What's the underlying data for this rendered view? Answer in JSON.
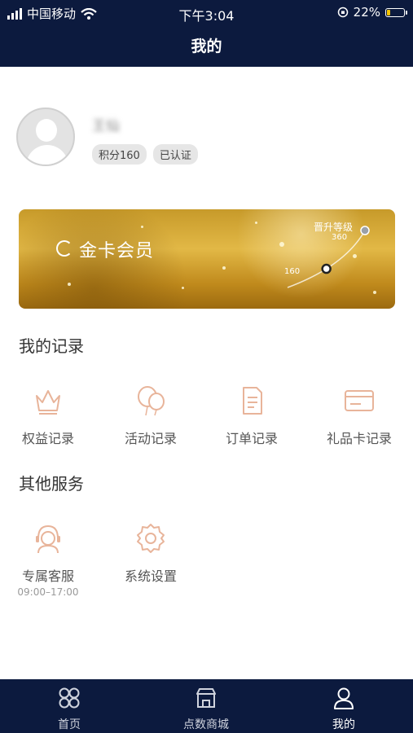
{
  "status_bar": {
    "carrier": "中国移动",
    "time": "下午3:04",
    "battery_pct": "22%",
    "battery_level": 0.22
  },
  "header": {
    "title": "我的"
  },
  "profile": {
    "username": "王仙",
    "points_badge": "积分160",
    "verified_badge": "已认证"
  },
  "member_card": {
    "title": "金卡会员",
    "upgrade_label": "晋升等级",
    "next_level_points": "360",
    "current_points": "160",
    "progress": 0.44,
    "accent": "#d4a437"
  },
  "records": {
    "title": "我的记录",
    "items": [
      {
        "label": "权益记录",
        "icon": "crown-icon"
      },
      {
        "label": "活动记录",
        "icon": "balloons-icon"
      },
      {
        "label": "订单记录",
        "icon": "document-icon"
      },
      {
        "label": "礼品卡记录",
        "icon": "card-icon"
      }
    ]
  },
  "services": {
    "title": "其他服务",
    "items": [
      {
        "label": "专属客服",
        "sub": "09:00–17:00",
        "icon": "headset-icon"
      },
      {
        "label": "系统设置",
        "icon": "gear-icon"
      }
    ]
  },
  "tabbar": {
    "items": [
      {
        "label": "首页",
        "icon": "home-grid-icon",
        "active": false
      },
      {
        "label": "点数商城",
        "icon": "store-icon",
        "active": false
      },
      {
        "label": "我的",
        "icon": "user-icon",
        "active": true
      }
    ]
  },
  "colors": {
    "nav_bg": "#0c1a3e",
    "icon_accent": "#e8b49a"
  }
}
